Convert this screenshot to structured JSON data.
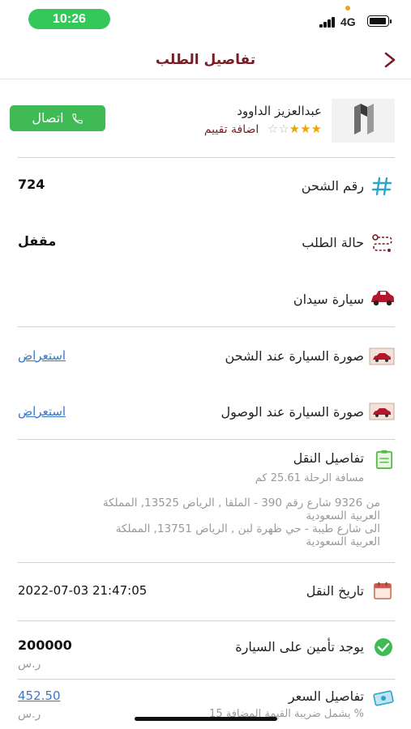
{
  "status_bar": {
    "time": "10:26",
    "network": "4G"
  },
  "header": {
    "title": "تفاصيل الطلب"
  },
  "provider": {
    "name": "عبدالعزيز الداوود",
    "rate_label": "اضافة تقييم",
    "stars_filled": 3,
    "stars_total": 5,
    "call_label": "اتصال"
  },
  "shipment_number": {
    "label": "رقم الشحن",
    "value": "724"
  },
  "order_status": {
    "label": "حالة الطلب",
    "value": "مقفل"
  },
  "car_type": {
    "label": "سيارة سيدان"
  },
  "photo_pickup": {
    "label": "صورة السيارة عند الشحن",
    "link": "استعراض"
  },
  "photo_arrival": {
    "label": "صورة السيارة عند الوصول",
    "link": "استعراض"
  },
  "transport": {
    "label": "تفاصيل النقل",
    "distance": "مسافة الرحلة 25.61 كم",
    "from_line1": "من   9326 شارع رقم 390 - الملقا , الرياض 13525, المملكة",
    "from_line2": "العربية السعودية",
    "to_line1": "الى  شارع طيبة - حي ظهرة لبن , الرياض 13751, المملكة",
    "to_line2": "العربية السعودية"
  },
  "transport_date": {
    "label": "تاريخ النقل",
    "value": "2022-07-03 21:47:05"
  },
  "insurance": {
    "label": "يوجد تأمين على السيارة",
    "value": "200000",
    "unit": "ر.س"
  },
  "price": {
    "label": "تفاصيل السعر",
    "value": "452.50",
    "unit": "ر.س",
    "vat_note": "يشمل ضريبة القيمة المضافة 15 %"
  },
  "colors": {
    "accent": "#7a1c24",
    "call_green": "#3fba55",
    "link_blue": "#3a78c8",
    "time_pill": "#34c759"
  }
}
